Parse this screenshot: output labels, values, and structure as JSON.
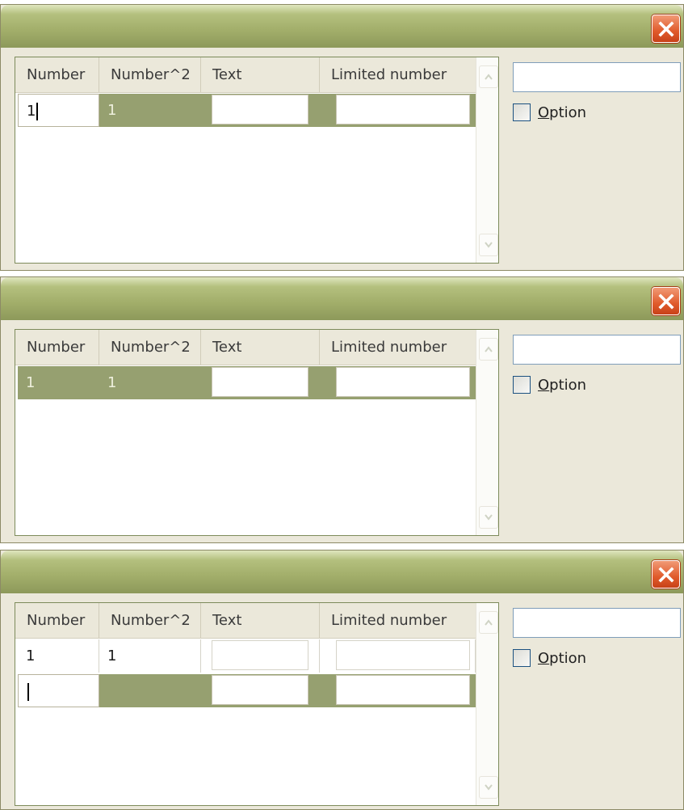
{
  "windows": [
    {
      "columns": [
        "Number",
        "Number^2",
        "Text",
        "Limited number"
      ],
      "rows": [
        {
          "number": "1",
          "number_sq": "1",
          "text": "",
          "limited": "",
          "state": "editing-first"
        }
      ],
      "side_input": "",
      "option": {
        "label_prefix": "",
        "label_mnemonic": "O",
        "label_rest": "ption",
        "checked": false
      }
    },
    {
      "columns": [
        "Number",
        "Number^2",
        "Text",
        "Limited number"
      ],
      "rows": [
        {
          "number": "1",
          "number_sq": "1",
          "text": "",
          "limited": "",
          "state": "selected"
        }
      ],
      "side_input": "",
      "option": {
        "label_prefix": "",
        "label_mnemonic": "O",
        "label_rest": "ption",
        "checked": false
      }
    },
    {
      "columns": [
        "Number",
        "Number^2",
        "Text",
        "Limited number"
      ],
      "rows": [
        {
          "number": "1",
          "number_sq": "1",
          "text": "",
          "limited": "",
          "state": "normal"
        },
        {
          "number": "",
          "number_sq": "",
          "text": "",
          "limited": "",
          "state": "editing-first-new"
        }
      ],
      "side_input": "",
      "option": {
        "label_prefix": "",
        "label_mnemonic": "O",
        "label_rest": "ption",
        "checked": false
      }
    }
  ],
  "icons": {
    "close": "close-x-icon",
    "scroll_up": "scroll-up-arrow-icon",
    "scroll_down": "scroll-down-arrow-icon"
  },
  "colors": {
    "titlebar": "#a4b06c",
    "selection": "#96a070",
    "close_button": "#e05a2b",
    "window_bg": "#ebe8da"
  }
}
